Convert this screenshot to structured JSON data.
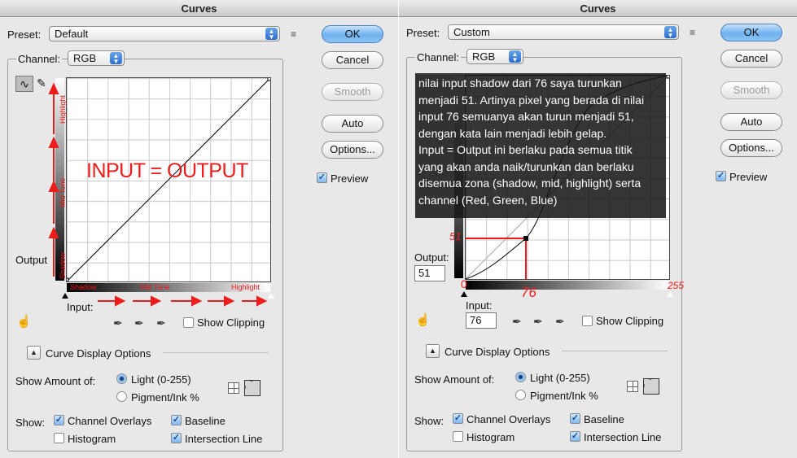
{
  "left": {
    "title": "Curves",
    "preset_label": "Preset:",
    "preset_value": "Default",
    "channel_label": "Channel:",
    "channel_value": "RGB",
    "buttons": {
      "ok": "OK",
      "cancel": "Cancel",
      "smooth": "Smooth",
      "auto": "Auto",
      "options": "Options..."
    },
    "preview_label": "Preview",
    "output_label": "Output",
    "input_label": "Input:",
    "show_clipping": "Show Clipping",
    "curve_display_options": "Curve Display Options",
    "show_amount_label": "Show Amount of:",
    "light_label": "Light  (0-255)",
    "pigment_label": "Pigment/Ink %",
    "show_label": "Show:",
    "channel_overlays": "Channel Overlays",
    "baseline": "Baseline",
    "histogram": "Histogram",
    "intersection_line": "Intersection Line",
    "annotation_main": "INPUT = OUTPUT",
    "vertical_labels": {
      "highlight": "Highlight",
      "midtone": "Mid Tone",
      "shadow": "Shadow"
    },
    "horizontal_labels": {
      "shadow": "Shadow",
      "midtone": "Mid Tone",
      "highlight": "Highlight"
    }
  },
  "right": {
    "title": "Curves",
    "preset_label": "Preset:",
    "preset_value": "Custom",
    "channel_label": "Channel:",
    "channel_value": "RGB",
    "buttons": {
      "ok": "OK",
      "cancel": "Cancel",
      "smooth": "Smooth",
      "auto": "Auto",
      "options": "Options..."
    },
    "preview_label": "Preview",
    "output_label": "Output:",
    "output_value": "51",
    "input_label": "Input:",
    "input_value": "76",
    "show_clipping": "Show Clipping",
    "curve_display_options": "Curve Display Options",
    "show_amount_label": "Show Amount of:",
    "light_label": "Light  (0-255)",
    "pigment_label": "Pigment/Ink %",
    "show_label": "Show:",
    "channel_overlays": "Channel Overlays",
    "baseline": "Baseline",
    "histogram": "Histogram",
    "intersection_line": "Intersection Line",
    "overlay_text": "nilai input shadow dari 76 saya turunkan\nmenjadi 51. Artinya pixel yang berada di nilai\ninput 76 semuanya akan turun menjadi 51,\ndengan kata lain menjadi lebih gelap.\nInput = Output ini berlaku pada semua titik\nyang akan anda naik/turunkan dan berlaku\ndisemua zona (shadow, mid, highlight) serta\nchannel (Red, Green, Blue)",
    "annotations": {
      "out_value": "51",
      "in_value": "76",
      "zero": "0",
      "max": "255"
    }
  },
  "colors": {
    "accent_red": "#ee1b1b",
    "button_blue": "#6fb1ef",
    "dialog_bg": "#e8e8e8"
  },
  "curve_points": {
    "input": 76,
    "output": 51
  }
}
